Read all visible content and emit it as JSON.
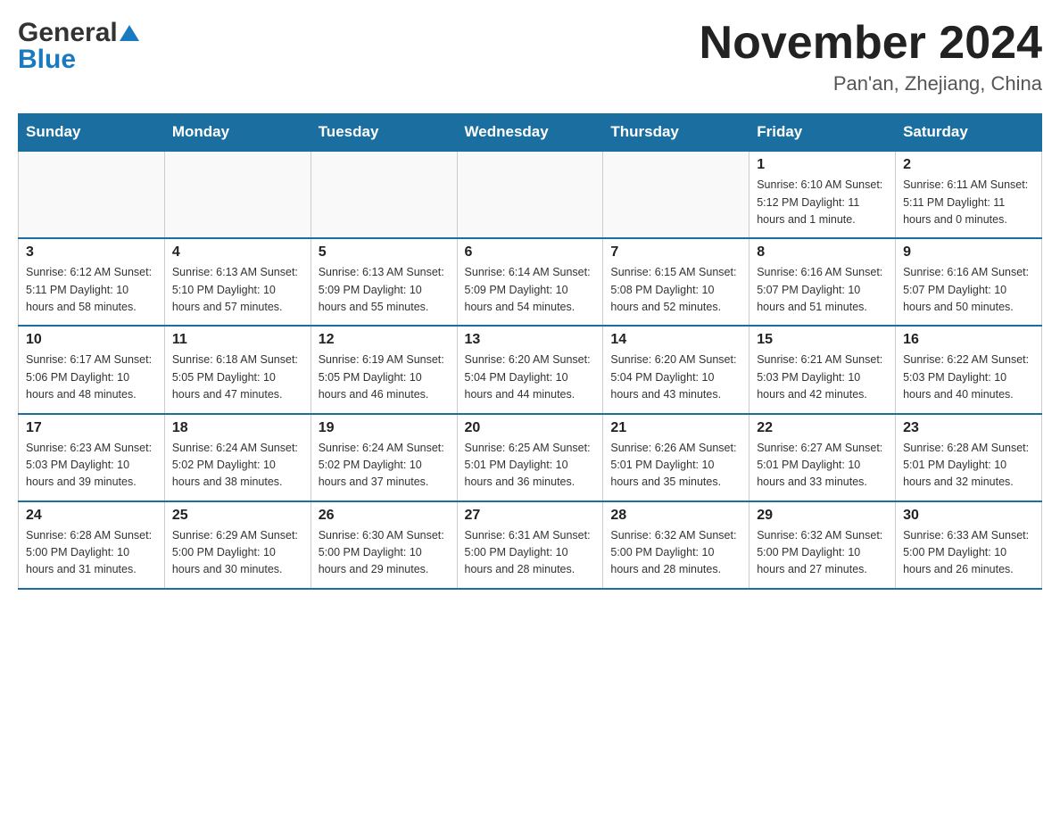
{
  "header": {
    "logo_general": "General",
    "logo_blue": "Blue",
    "month_year": "November 2024",
    "location": "Pan'an, Zhejiang, China"
  },
  "calendar": {
    "days_of_week": [
      "Sunday",
      "Monday",
      "Tuesday",
      "Wednesday",
      "Thursday",
      "Friday",
      "Saturday"
    ],
    "weeks": [
      {
        "days": [
          {
            "number": "",
            "info": ""
          },
          {
            "number": "",
            "info": ""
          },
          {
            "number": "",
            "info": ""
          },
          {
            "number": "",
            "info": ""
          },
          {
            "number": "",
            "info": ""
          },
          {
            "number": "1",
            "info": "Sunrise: 6:10 AM\nSunset: 5:12 PM\nDaylight: 11 hours and 1 minute."
          },
          {
            "number": "2",
            "info": "Sunrise: 6:11 AM\nSunset: 5:11 PM\nDaylight: 11 hours and 0 minutes."
          }
        ]
      },
      {
        "days": [
          {
            "number": "3",
            "info": "Sunrise: 6:12 AM\nSunset: 5:11 PM\nDaylight: 10 hours and 58 minutes."
          },
          {
            "number": "4",
            "info": "Sunrise: 6:13 AM\nSunset: 5:10 PM\nDaylight: 10 hours and 57 minutes."
          },
          {
            "number": "5",
            "info": "Sunrise: 6:13 AM\nSunset: 5:09 PM\nDaylight: 10 hours and 55 minutes."
          },
          {
            "number": "6",
            "info": "Sunrise: 6:14 AM\nSunset: 5:09 PM\nDaylight: 10 hours and 54 minutes."
          },
          {
            "number": "7",
            "info": "Sunrise: 6:15 AM\nSunset: 5:08 PM\nDaylight: 10 hours and 52 minutes."
          },
          {
            "number": "8",
            "info": "Sunrise: 6:16 AM\nSunset: 5:07 PM\nDaylight: 10 hours and 51 minutes."
          },
          {
            "number": "9",
            "info": "Sunrise: 6:16 AM\nSunset: 5:07 PM\nDaylight: 10 hours and 50 minutes."
          }
        ]
      },
      {
        "days": [
          {
            "number": "10",
            "info": "Sunrise: 6:17 AM\nSunset: 5:06 PM\nDaylight: 10 hours and 48 minutes."
          },
          {
            "number": "11",
            "info": "Sunrise: 6:18 AM\nSunset: 5:05 PM\nDaylight: 10 hours and 47 minutes."
          },
          {
            "number": "12",
            "info": "Sunrise: 6:19 AM\nSunset: 5:05 PM\nDaylight: 10 hours and 46 minutes."
          },
          {
            "number": "13",
            "info": "Sunrise: 6:20 AM\nSunset: 5:04 PM\nDaylight: 10 hours and 44 minutes."
          },
          {
            "number": "14",
            "info": "Sunrise: 6:20 AM\nSunset: 5:04 PM\nDaylight: 10 hours and 43 minutes."
          },
          {
            "number": "15",
            "info": "Sunrise: 6:21 AM\nSunset: 5:03 PM\nDaylight: 10 hours and 42 minutes."
          },
          {
            "number": "16",
            "info": "Sunrise: 6:22 AM\nSunset: 5:03 PM\nDaylight: 10 hours and 40 minutes."
          }
        ]
      },
      {
        "days": [
          {
            "number": "17",
            "info": "Sunrise: 6:23 AM\nSunset: 5:03 PM\nDaylight: 10 hours and 39 minutes."
          },
          {
            "number": "18",
            "info": "Sunrise: 6:24 AM\nSunset: 5:02 PM\nDaylight: 10 hours and 38 minutes."
          },
          {
            "number": "19",
            "info": "Sunrise: 6:24 AM\nSunset: 5:02 PM\nDaylight: 10 hours and 37 minutes."
          },
          {
            "number": "20",
            "info": "Sunrise: 6:25 AM\nSunset: 5:01 PM\nDaylight: 10 hours and 36 minutes."
          },
          {
            "number": "21",
            "info": "Sunrise: 6:26 AM\nSunset: 5:01 PM\nDaylight: 10 hours and 35 minutes."
          },
          {
            "number": "22",
            "info": "Sunrise: 6:27 AM\nSunset: 5:01 PM\nDaylight: 10 hours and 33 minutes."
          },
          {
            "number": "23",
            "info": "Sunrise: 6:28 AM\nSunset: 5:01 PM\nDaylight: 10 hours and 32 minutes."
          }
        ]
      },
      {
        "days": [
          {
            "number": "24",
            "info": "Sunrise: 6:28 AM\nSunset: 5:00 PM\nDaylight: 10 hours and 31 minutes."
          },
          {
            "number": "25",
            "info": "Sunrise: 6:29 AM\nSunset: 5:00 PM\nDaylight: 10 hours and 30 minutes."
          },
          {
            "number": "26",
            "info": "Sunrise: 6:30 AM\nSunset: 5:00 PM\nDaylight: 10 hours and 29 minutes."
          },
          {
            "number": "27",
            "info": "Sunrise: 6:31 AM\nSunset: 5:00 PM\nDaylight: 10 hours and 28 minutes."
          },
          {
            "number": "28",
            "info": "Sunrise: 6:32 AM\nSunset: 5:00 PM\nDaylight: 10 hours and 28 minutes."
          },
          {
            "number": "29",
            "info": "Sunrise: 6:32 AM\nSunset: 5:00 PM\nDaylight: 10 hours and 27 minutes."
          },
          {
            "number": "30",
            "info": "Sunrise: 6:33 AM\nSunset: 5:00 PM\nDaylight: 10 hours and 26 minutes."
          }
        ]
      }
    ]
  }
}
